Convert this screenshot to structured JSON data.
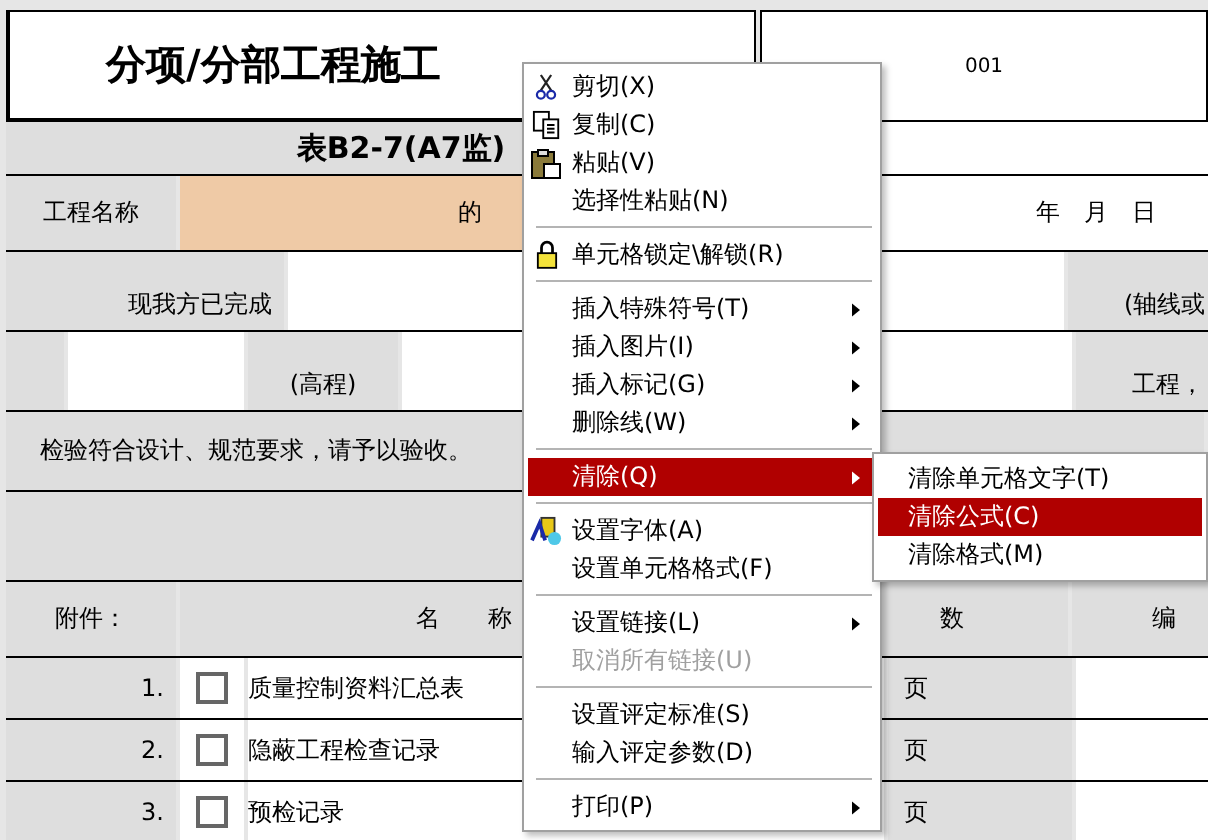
{
  "sheet": {
    "title": "分项/分部工程施工",
    "code": "001",
    "form_no": "表B2-7(A7监)",
    "project_label": "工程名称",
    "project_value": "的",
    "date": "年　月　日",
    "completed_label": "现我方已完成",
    "axis_label": "(轴线或",
    "elevation_label": "(高程)",
    "work_label": "工程，",
    "request_text": "检验符合设计、规范要求，请予以验收。",
    "attachments_label": "附件：",
    "name_header": "名　　称",
    "pages_header": "数",
    "code_header": "编",
    "attachments": [
      {
        "number": "1.",
        "checked": false,
        "name": "质量控制资料汇总表",
        "page_unit": "页"
      },
      {
        "number": "2.",
        "checked": false,
        "name": "隐蔽工程检查记录",
        "page_unit": "页"
      },
      {
        "number": "3.",
        "checked": false,
        "name": "预检记录",
        "page_unit": "页"
      }
    ]
  },
  "menu": {
    "items": [
      {
        "kind": "item",
        "label": "剪切(X)",
        "selected": false,
        "disabled": false,
        "submenu": false
      },
      {
        "kind": "item",
        "label": "复制(C)",
        "selected": false,
        "disabled": false,
        "submenu": false
      },
      {
        "kind": "item",
        "label": "粘贴(V)",
        "selected": false,
        "disabled": false,
        "submenu": false
      },
      {
        "kind": "item",
        "label": "选择性粘贴(N)",
        "selected": false,
        "disabled": false,
        "submenu": false
      },
      {
        "kind": "separator"
      },
      {
        "kind": "item",
        "label": "单元格锁定\\解锁(R)",
        "selected": false,
        "disabled": false,
        "submenu": false
      },
      {
        "kind": "separator"
      },
      {
        "kind": "item",
        "label": "插入特殊符号(T)",
        "selected": false,
        "disabled": false,
        "submenu": true
      },
      {
        "kind": "item",
        "label": "插入图片(I)",
        "selected": false,
        "disabled": false,
        "submenu": true
      },
      {
        "kind": "item",
        "label": "插入标记(G)",
        "selected": false,
        "disabled": false,
        "submenu": true
      },
      {
        "kind": "item",
        "label": "删除线(W)",
        "selected": false,
        "disabled": false,
        "submenu": true
      },
      {
        "kind": "separator"
      },
      {
        "kind": "item",
        "label": "清除(Q)",
        "selected": true,
        "disabled": false,
        "submenu": true
      },
      {
        "kind": "separator"
      },
      {
        "kind": "item",
        "label": "设置字体(A)",
        "selected": false,
        "disabled": false,
        "submenu": false
      },
      {
        "kind": "item",
        "label": "设置单元格格式(F)",
        "selected": false,
        "disabled": false,
        "submenu": false
      },
      {
        "kind": "separator"
      },
      {
        "kind": "item",
        "label": "设置链接(L)",
        "selected": false,
        "disabled": false,
        "submenu": true
      },
      {
        "kind": "item",
        "label": "取消所有链接(U)",
        "selected": false,
        "disabled": true,
        "submenu": false
      },
      {
        "kind": "separator"
      },
      {
        "kind": "item",
        "label": "设置评定标准(S)",
        "selected": false,
        "disabled": false,
        "submenu": false
      },
      {
        "kind": "item",
        "label": "输入评定参数(D)",
        "selected": false,
        "disabled": false,
        "submenu": false
      },
      {
        "kind": "separator"
      },
      {
        "kind": "item",
        "label": "打印(P)",
        "selected": false,
        "disabled": false,
        "submenu": true
      }
    ]
  },
  "submenu": {
    "items": [
      {
        "label": "清除单元格文字(T)",
        "selected": false
      },
      {
        "label": "清除公式(C)",
        "selected": true
      },
      {
        "label": "清除格式(M)",
        "selected": false
      }
    ]
  }
}
